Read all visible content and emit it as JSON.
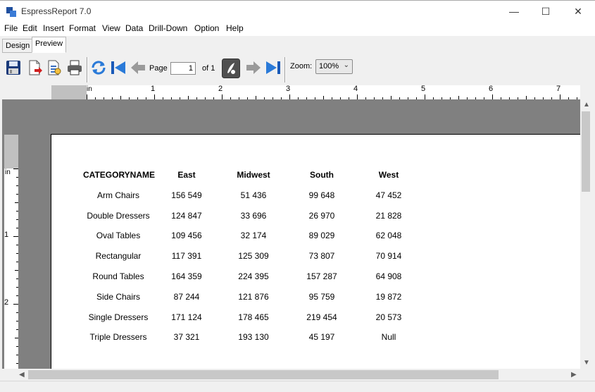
{
  "window": {
    "title": "EspressReport 7.0",
    "minimize": "—",
    "maximize": "☐",
    "close": "✕"
  },
  "menu": [
    "File",
    "Edit",
    "Insert",
    "Format",
    "View",
    "Data",
    "Drill-Down",
    "Option",
    "Help"
  ],
  "tabs": [
    {
      "label": "Design",
      "active": false
    },
    {
      "label": "Preview",
      "active": true
    }
  ],
  "toolbar": {
    "page_label": "Page",
    "page_value": "1",
    "of_label": "of 1",
    "zoom_label": "Zoom:",
    "zoom_value": "100%"
  },
  "ruler": {
    "unit": "in",
    "h_ticks": [
      "1",
      "2",
      "3",
      "4",
      "5",
      "6",
      "7"
    ],
    "v_ticks": [
      "1",
      "2"
    ]
  },
  "report": {
    "headers": [
      "CATEGORYNAME",
      "East",
      "Midwest",
      "South",
      "West"
    ],
    "rows": [
      [
        "Arm Chairs",
        "156 549",
        "51 436",
        "99 648",
        "47 452"
      ],
      [
        "Double Dressers",
        "124 847",
        "33 696",
        "26 970",
        "21 828"
      ],
      [
        "Oval Tables",
        "109 456",
        "32 174",
        "89 029",
        "62 048"
      ],
      [
        "Rectangular",
        "117 391",
        "125 309",
        "73 807",
        "70 914"
      ],
      [
        "Round Tables",
        "164 359",
        "224 395",
        "157 287",
        "64 908"
      ],
      [
        "Side Chairs",
        "87 244",
        "121 876",
        "95 759",
        "19 872"
      ],
      [
        "Single Dressers",
        "171 124",
        "178 465",
        "219 454",
        "20 573"
      ],
      [
        "Triple Dressers",
        "37 321",
        "193 130",
        "45 197",
        "Null"
      ]
    ]
  }
}
